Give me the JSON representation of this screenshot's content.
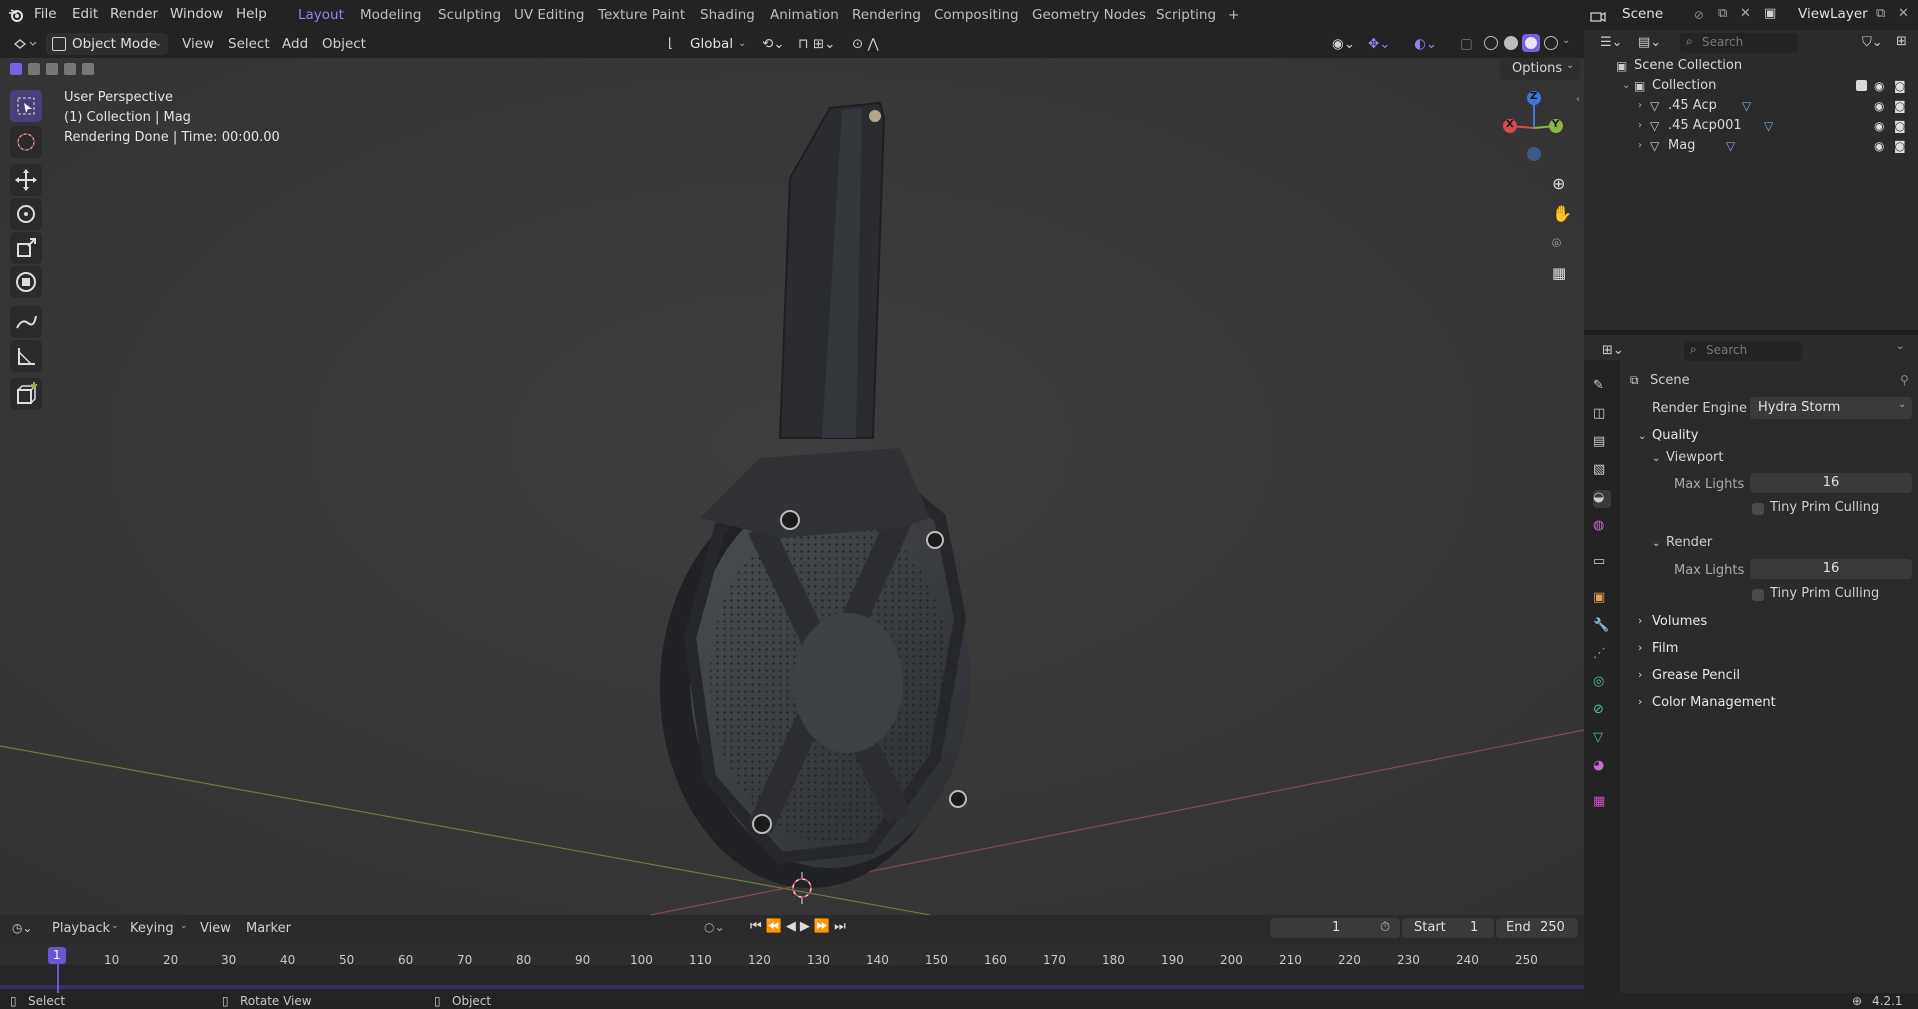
{
  "menu": {
    "file": "File",
    "edit": "Edit",
    "render": "Render",
    "window": "Window",
    "help": "Help"
  },
  "workspaces": [
    {
      "label": "Layout",
      "active": true
    },
    {
      "label": "Modeling",
      "active": false
    },
    {
      "label": "Sculpting",
      "active": false
    },
    {
      "label": "UV Editing",
      "active": false
    },
    {
      "label": "Texture Paint",
      "active": false
    },
    {
      "label": "Shading",
      "active": false
    },
    {
      "label": "Animation",
      "active": false
    },
    {
      "label": "Rendering",
      "active": false
    },
    {
      "label": "Compositing",
      "active": false
    },
    {
      "label": "Geometry Nodes",
      "active": false
    },
    {
      "label": "Scripting",
      "active": false
    }
  ],
  "add_workspace": "+",
  "scene_name": "Scene",
  "view_layer": "ViewLayer",
  "header": {
    "mode": "Object Mode",
    "view": "View",
    "select": "Select",
    "add": "Add",
    "object": "Object",
    "transform_orientation": "Global",
    "options": "Options"
  },
  "viewport_overlay": {
    "line1": "User Perspective",
    "line2": "(1) Collection | Mag",
    "line3": "Rendering Done | Time: 00:00.00"
  },
  "gizmo": {
    "x": "X",
    "y": "Y",
    "z": "Z"
  },
  "outliner": {
    "search_placeholder": "Search",
    "root": "Scene Collection",
    "collection": "Collection",
    "items": [
      {
        "label": ".45 Acp"
      },
      {
        "label": ".45 Acp001"
      },
      {
        "label": "Mag"
      }
    ]
  },
  "properties": {
    "search_placeholder": "Search",
    "context": "Scene",
    "render_engine_label": "Render Engine",
    "render_engine_value": "Hydra Storm",
    "quality": "Quality",
    "viewport": "Viewport",
    "max_lights_label": "Max Lights",
    "viewport_max_lights": "16",
    "tiny_prim": "Tiny Prim Culling",
    "render": "Render",
    "render_max_lights": "16",
    "volumes": "Volumes",
    "film": "Film",
    "grease_pencil": "Grease Pencil",
    "color_management": "Color Management"
  },
  "timeline": {
    "playback": "Playback",
    "keying": "Keying",
    "view": "View",
    "marker": "Marker",
    "current_frame": "1",
    "start_label": "Start",
    "start": "1",
    "end_label": "End",
    "end": "250",
    "ruler": [
      "1",
      "10",
      "20",
      "30",
      "40",
      "50",
      "60",
      "70",
      "80",
      "90",
      "100",
      "110",
      "120",
      "130",
      "140",
      "150",
      "160",
      "170",
      "180",
      "190",
      "200",
      "210",
      "220",
      "230",
      "240",
      "250"
    ]
  },
  "status": {
    "select": "Select",
    "rotate": "Rotate View",
    "object": "Object",
    "version": "4.2.1"
  },
  "colors": {
    "accent": "#7a5fe0",
    "active_tab": "#9d7ff3",
    "x_axis": "#d84a52",
    "y_axis": "#8ab545",
    "z_axis": "#3d78d8"
  }
}
